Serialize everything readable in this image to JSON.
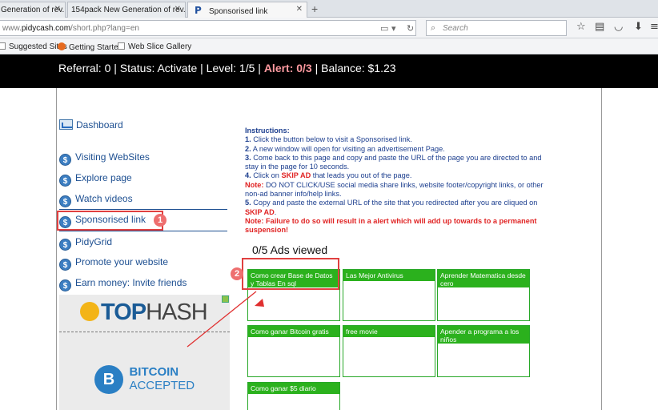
{
  "browser": {
    "tabs": [
      {
        "title": "Generation of rev..."
      },
      {
        "title": "154pack New Generation of rev..."
      },
      {
        "title": "Sponsorised link"
      }
    ],
    "url_prefix": "www.",
    "url_domain": "pidycash.com",
    "url_path": "/short.php?lang=en",
    "search_placeholder": "Search",
    "bookmarks": [
      "Suggested Sites",
      "Getting Started",
      "Web Slice Gallery"
    ]
  },
  "header": {
    "referral": "Referral: 0 | Status: Activate | Level: 1/5 | ",
    "alert": "Alert: 0/3",
    "balance": " | Balance: $1.23"
  },
  "sidebar": {
    "dashboard": "Dashboard",
    "items": [
      "Visiting WebSites",
      "Explore page",
      "Watch videos",
      "Sponsorised link",
      "PidyGrid",
      "Promote your website",
      "Earn money: Invite friends"
    ],
    "badge1": "1",
    "ad_top": {
      "brand1": "TOP",
      "brand2": "HASH"
    },
    "ad_btc": {
      "symbol": "B",
      "line1": "BITCOIN",
      "line2": "ACCEPTED"
    }
  },
  "instructions": {
    "title": "Instructions:",
    "s1n": "1.",
    "s1": " Click the button below to visit a Sponsorised link.",
    "s2n": "2.",
    "s2": " A new window will open for visiting an advertisement Page.",
    "s3n": "3.",
    "s3": " Come back to this page and copy and paste the URL of the page you are directed to and stay in the page for 10 seconds.",
    "s4n": "4.",
    "s4a": " Click on ",
    "s4skip": "SKIP AD",
    "s4b": " that leads you out of the page.",
    "note1": "Note:",
    "note1_text": " DO NOT CLICK/USE social media share links, website footer/copyright links, or other non-ad banner info/help links.",
    "s5n": "5.",
    "s5": " Copy and paste the external URL of the site that you redirected after you are cliqued on ",
    "s5skip": "SKIP AD",
    "s5end": ".",
    "note2": "Note: Failure to do so will result in a alert which will add up towards to a permanent suspension!"
  },
  "ads": {
    "count": "0/5 Ads viewed",
    "badge2": "2",
    "items": [
      "Como crear Base de Datos y Tablas En sql",
      "Las Mejor Antivirus",
      "Aprender Matematica desde cero",
      "Como ganar Bitcoin gratis",
      "free movie",
      "Apender a programa a los niños",
      "Como ganar $5 diario"
    ]
  },
  "colors": {
    "accent_green": "#2bb11d",
    "alert_red": "#e02424",
    "link_blue": "#1d4f91"
  }
}
